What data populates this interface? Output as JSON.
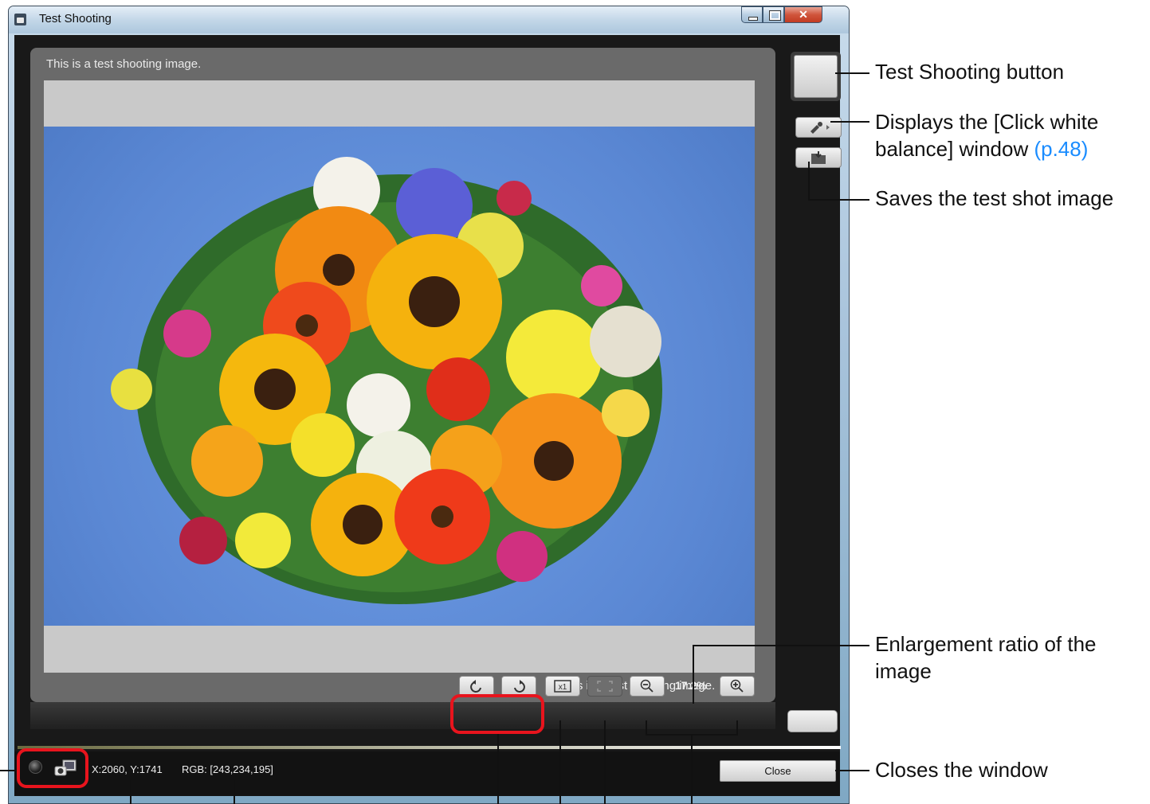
{
  "window": {
    "title": "Test Shooting",
    "caption_top": "This is a test shooting image.",
    "caption_bottom": "This is a test shooting image.",
    "zoom_ratio": "17.2%",
    "status": {
      "coords": "X:2060, Y:1741",
      "rgb": "RGB: [243,234,195]"
    },
    "close_label": "Close"
  },
  "annotations": {
    "test_shooting": "Test Shooting button",
    "click_wb_line1": "Displays the [Click white",
    "click_wb_line2": "balance] window",
    "click_wb_ref": "(p.48)",
    "save_shot": "Saves the test shot image",
    "ratio_line1": "Enlargement ratio of the",
    "ratio_line2": "image",
    "closes": "Closes the window"
  },
  "colors": {
    "highlight": "#e8141d",
    "link": "#1a8cff",
    "photo_background": "#5c8ad6"
  }
}
